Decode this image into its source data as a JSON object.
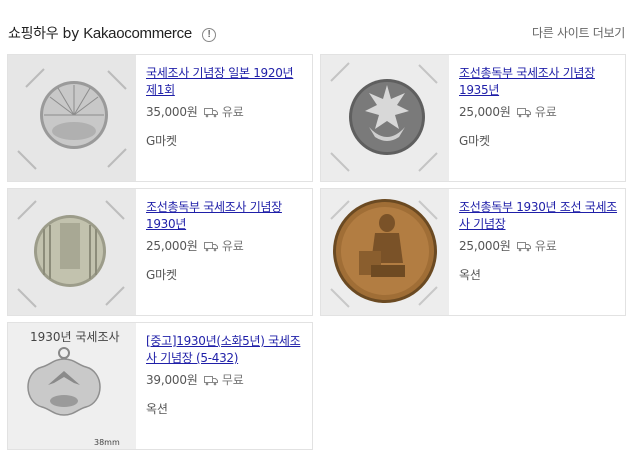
{
  "header": {
    "title": "쇼핑하우",
    "by": "by",
    "brand": "Kakaocommerce",
    "info_icon": "!",
    "more_link": "다른 사이트 더보기"
  },
  "products": [
    {
      "title": "국세조사 기념장 일본 1920년 제1회",
      "price": "35,000원",
      "shipping": "유료",
      "mall": "G마켓"
    },
    {
      "title": "조선총독부 국세조사 기념장 1935년",
      "price": "25,000원",
      "shipping": "유료",
      "mall": "G마켓"
    },
    {
      "title": "조선총독부 국세조사 기념장 1930년",
      "price": "25,000원",
      "shipping": "유료",
      "mall": "G마켓"
    },
    {
      "title": "조선총독부 1930년 조선 국세조사 기념장",
      "price": "25,000원",
      "shipping": "유료",
      "mall": "옥션"
    },
    {
      "title": "[중고]1930년(소화5년) 국세조사 기념장 (5-432)",
      "price": "39,000원",
      "shipping": "무료",
      "mall": "옥션"
    }
  ],
  "photo_text": {
    "handwriting_top": "1930년 국세조사",
    "handwriting_bottom": "38mm"
  },
  "colors": {
    "link": "#1f1fa8",
    "text": "#555555",
    "border": "#e2e2e2"
  },
  "icons": [
    "info-icon",
    "truck-icon"
  ]
}
